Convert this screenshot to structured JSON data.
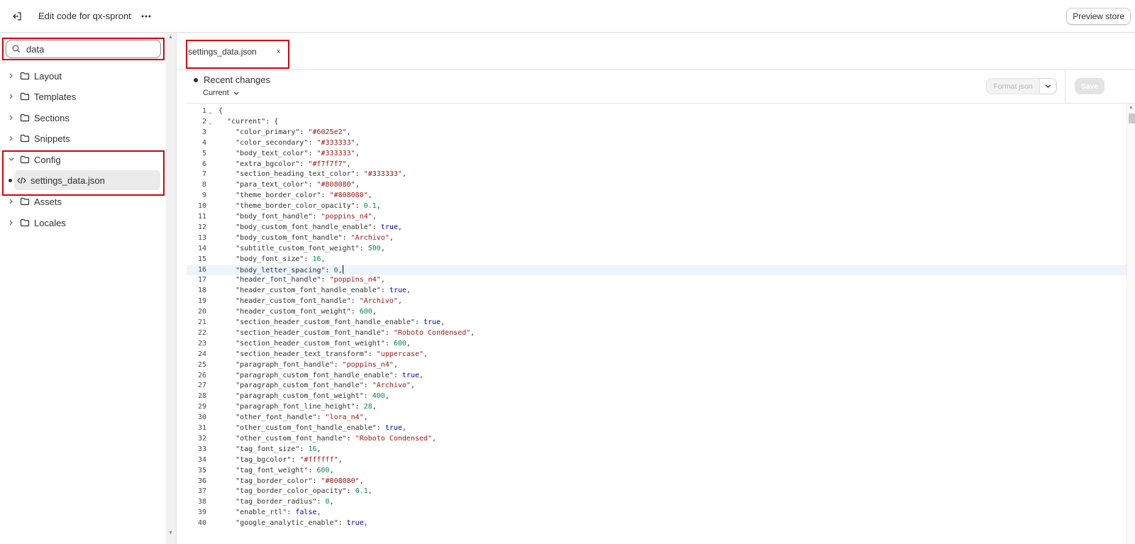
{
  "header": {
    "title": "Edit code for qx-spront",
    "preview_label": "Preview store"
  },
  "sidebar": {
    "search_value": "data",
    "folders": [
      {
        "label": "Layout",
        "expanded": false
      },
      {
        "label": "Templates",
        "expanded": false
      },
      {
        "label": "Sections",
        "expanded": false
      },
      {
        "label": "Snippets",
        "expanded": false
      },
      {
        "label": "Config",
        "expanded": true
      },
      {
        "label": "Assets",
        "expanded": false
      },
      {
        "label": "Locales",
        "expanded": false
      }
    ],
    "open_file": "settings_data.json"
  },
  "editor": {
    "tab_label": "settings_data.json",
    "tab_close": "×",
    "recent_changes": "Recent changes",
    "current_label": "Current",
    "format_label": "Format json",
    "save_label": "Save",
    "active_line": 16,
    "lines": [
      "{",
      "  \"current\": {",
      "    \"color_primary\": \"#6025e2\",",
      "    \"color_secondary\": \"#333333\",",
      "    \"body_text_color\": \"#333333\",",
      "    \"extra_bgcolor\": \"#f7f7f7\",",
      "    \"section_heading_text_color\": \"#333333\",",
      "    \"para_text_color\": \"#808080\",",
      "    \"theme_border_color\": \"#808080\",",
      "    \"theme_border_color_opacity\": 0.1,",
      "    \"body_font_handle\": \"poppins_n4\",",
      "    \"body_custom_font_handle_enable\": true,",
      "    \"body_custom_font_handle\": \"Archivo\",",
      "    \"subtitle_custom_font_weight\": 500,",
      "    \"body_font_size\": 16,",
      "    \"body_letter_spacing\": 0,",
      "    \"header_font_handle\": \"poppins_n4\",",
      "    \"header_custom_font_handle_enable\": true,",
      "    \"header_custom_font_handle\": \"Archivo\",",
      "    \"header_custom_font_weight\": 600,",
      "    \"section_header_custom_font_handle_enable\": true,",
      "    \"section_header_custom_font_handle\": \"Roboto Condensed\",",
      "    \"section_header_custom_font_weight\": 600,",
      "    \"section_header_text_transform\": \"uppercase\",",
      "    \"paragraph_font_handle\": \"poppins_n4\",",
      "    \"paragraph_custom_font_handle_enable\": true,",
      "    \"paragraph_custom_font_handle\": \"Archivo\",",
      "    \"paragraph_custom_font_weight\": 400,",
      "    \"paragraph_font_line_height\": 28,",
      "    \"other_font_handle\": \"lora_n4\",",
      "    \"other_custom_font_handle_enable\": true,",
      "    \"other_custom_font_handle\": \"Roboto Condensed\",",
      "    \"tag_font_size\": 16,",
      "    \"tag_bgcolor\": \"#ffffff\",",
      "    \"tag_font_weight\": 600,",
      "    \"tag_border_color\": \"#808080\",",
      "    \"tag_border_color_opacity\": 0.1,",
      "    \"tag_border_radius\": 0,",
      "    \"enable_rtl\": false,",
      "    \"google_analytic_enable\": true,"
    ]
  },
  "icons": {
    "exit": "exit-icon",
    "more": "more-icon",
    "search": "search-icon",
    "folder": "folder-icon",
    "code": "code-icon",
    "chevron": "chevron-icon"
  },
  "colors": {
    "highlight": "#d8000c",
    "string": "#a31515",
    "number": "#098658",
    "boolean": "#0000aa",
    "active_line": "#edf4fc"
  }
}
